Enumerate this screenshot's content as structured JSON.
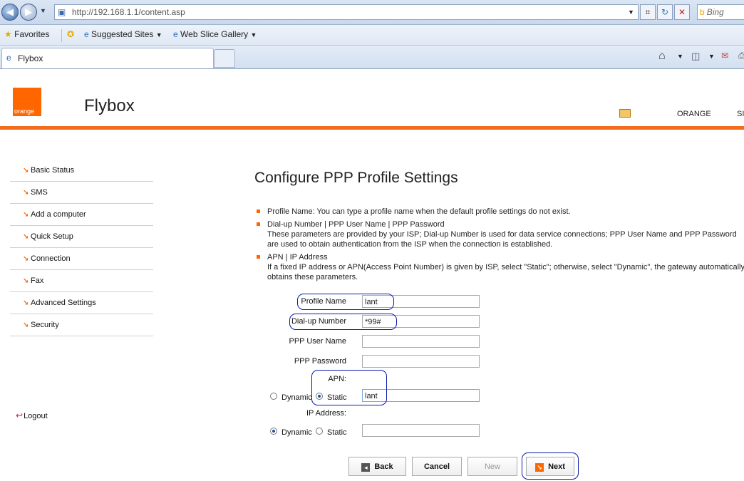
{
  "browser": {
    "address": "http://192.168.1.1/content.asp",
    "search_provider": "Bing",
    "favorites_bar": {
      "favorites": "Favorites",
      "suggested_sites": "Suggested Sites",
      "web_slice_gallery": "Web Slice Gallery"
    },
    "tab_title": "Flybox"
  },
  "header": {
    "logo_text": "orange",
    "brand": "Flybox",
    "links": [
      "ORANGE",
      "SI"
    ]
  },
  "sidebar": {
    "items": [
      {
        "label": "Basic Status"
      },
      {
        "label": "SMS"
      },
      {
        "label": "Add a computer"
      },
      {
        "label": "Quick Setup"
      },
      {
        "label": "Connection"
      },
      {
        "label": "Fax"
      },
      {
        "label": "Advanced Settings"
      },
      {
        "label": "Security"
      }
    ],
    "logout": "Logout"
  },
  "main": {
    "title": "Configure PPP Profile Settings",
    "notes": [
      {
        "heading": "Profile Name: You can type a profile name when the default profile settings do not exist.",
        "body": ""
      },
      {
        "heading": "Dial-up Number | PPP User Name | PPP Password",
        "body": "These parameters are provided by your ISP; Dial-up Number is used for data service connections; PPP User Name and PPP Password are used to obtain authentication from the ISP when the connection is established."
      },
      {
        "heading": "APN | IP Address",
        "body": "If a fixed IP address or APN(Access Point Number) is given by ISP, select \"Static\"; otherwise, select \"Dynamic\", the gateway automatically obtains these parameters."
      }
    ],
    "form": {
      "profile_name": {
        "label": "Profile Name",
        "value": "lant"
      },
      "dialup_number": {
        "label": "Dial-up Number",
        "value": "*99#"
      },
      "ppp_user": {
        "label": "PPP User Name",
        "value": ""
      },
      "ppp_password": {
        "label": "PPP Password",
        "value": ""
      },
      "apn": {
        "label": "APN:",
        "dynamic": "Dynamic",
        "static": "Static",
        "selected": "Static",
        "value": "lant"
      },
      "ip": {
        "label": "IP Address:",
        "dynamic": "Dynamic",
        "static": "Static",
        "selected": "Dynamic",
        "value": ""
      }
    },
    "buttons": {
      "back": "Back",
      "cancel": "Cancel",
      "new": "New",
      "next": "Next"
    }
  },
  "colors": {
    "accent": "#ff6600",
    "highlight_circle": "#0b1aa8"
  }
}
